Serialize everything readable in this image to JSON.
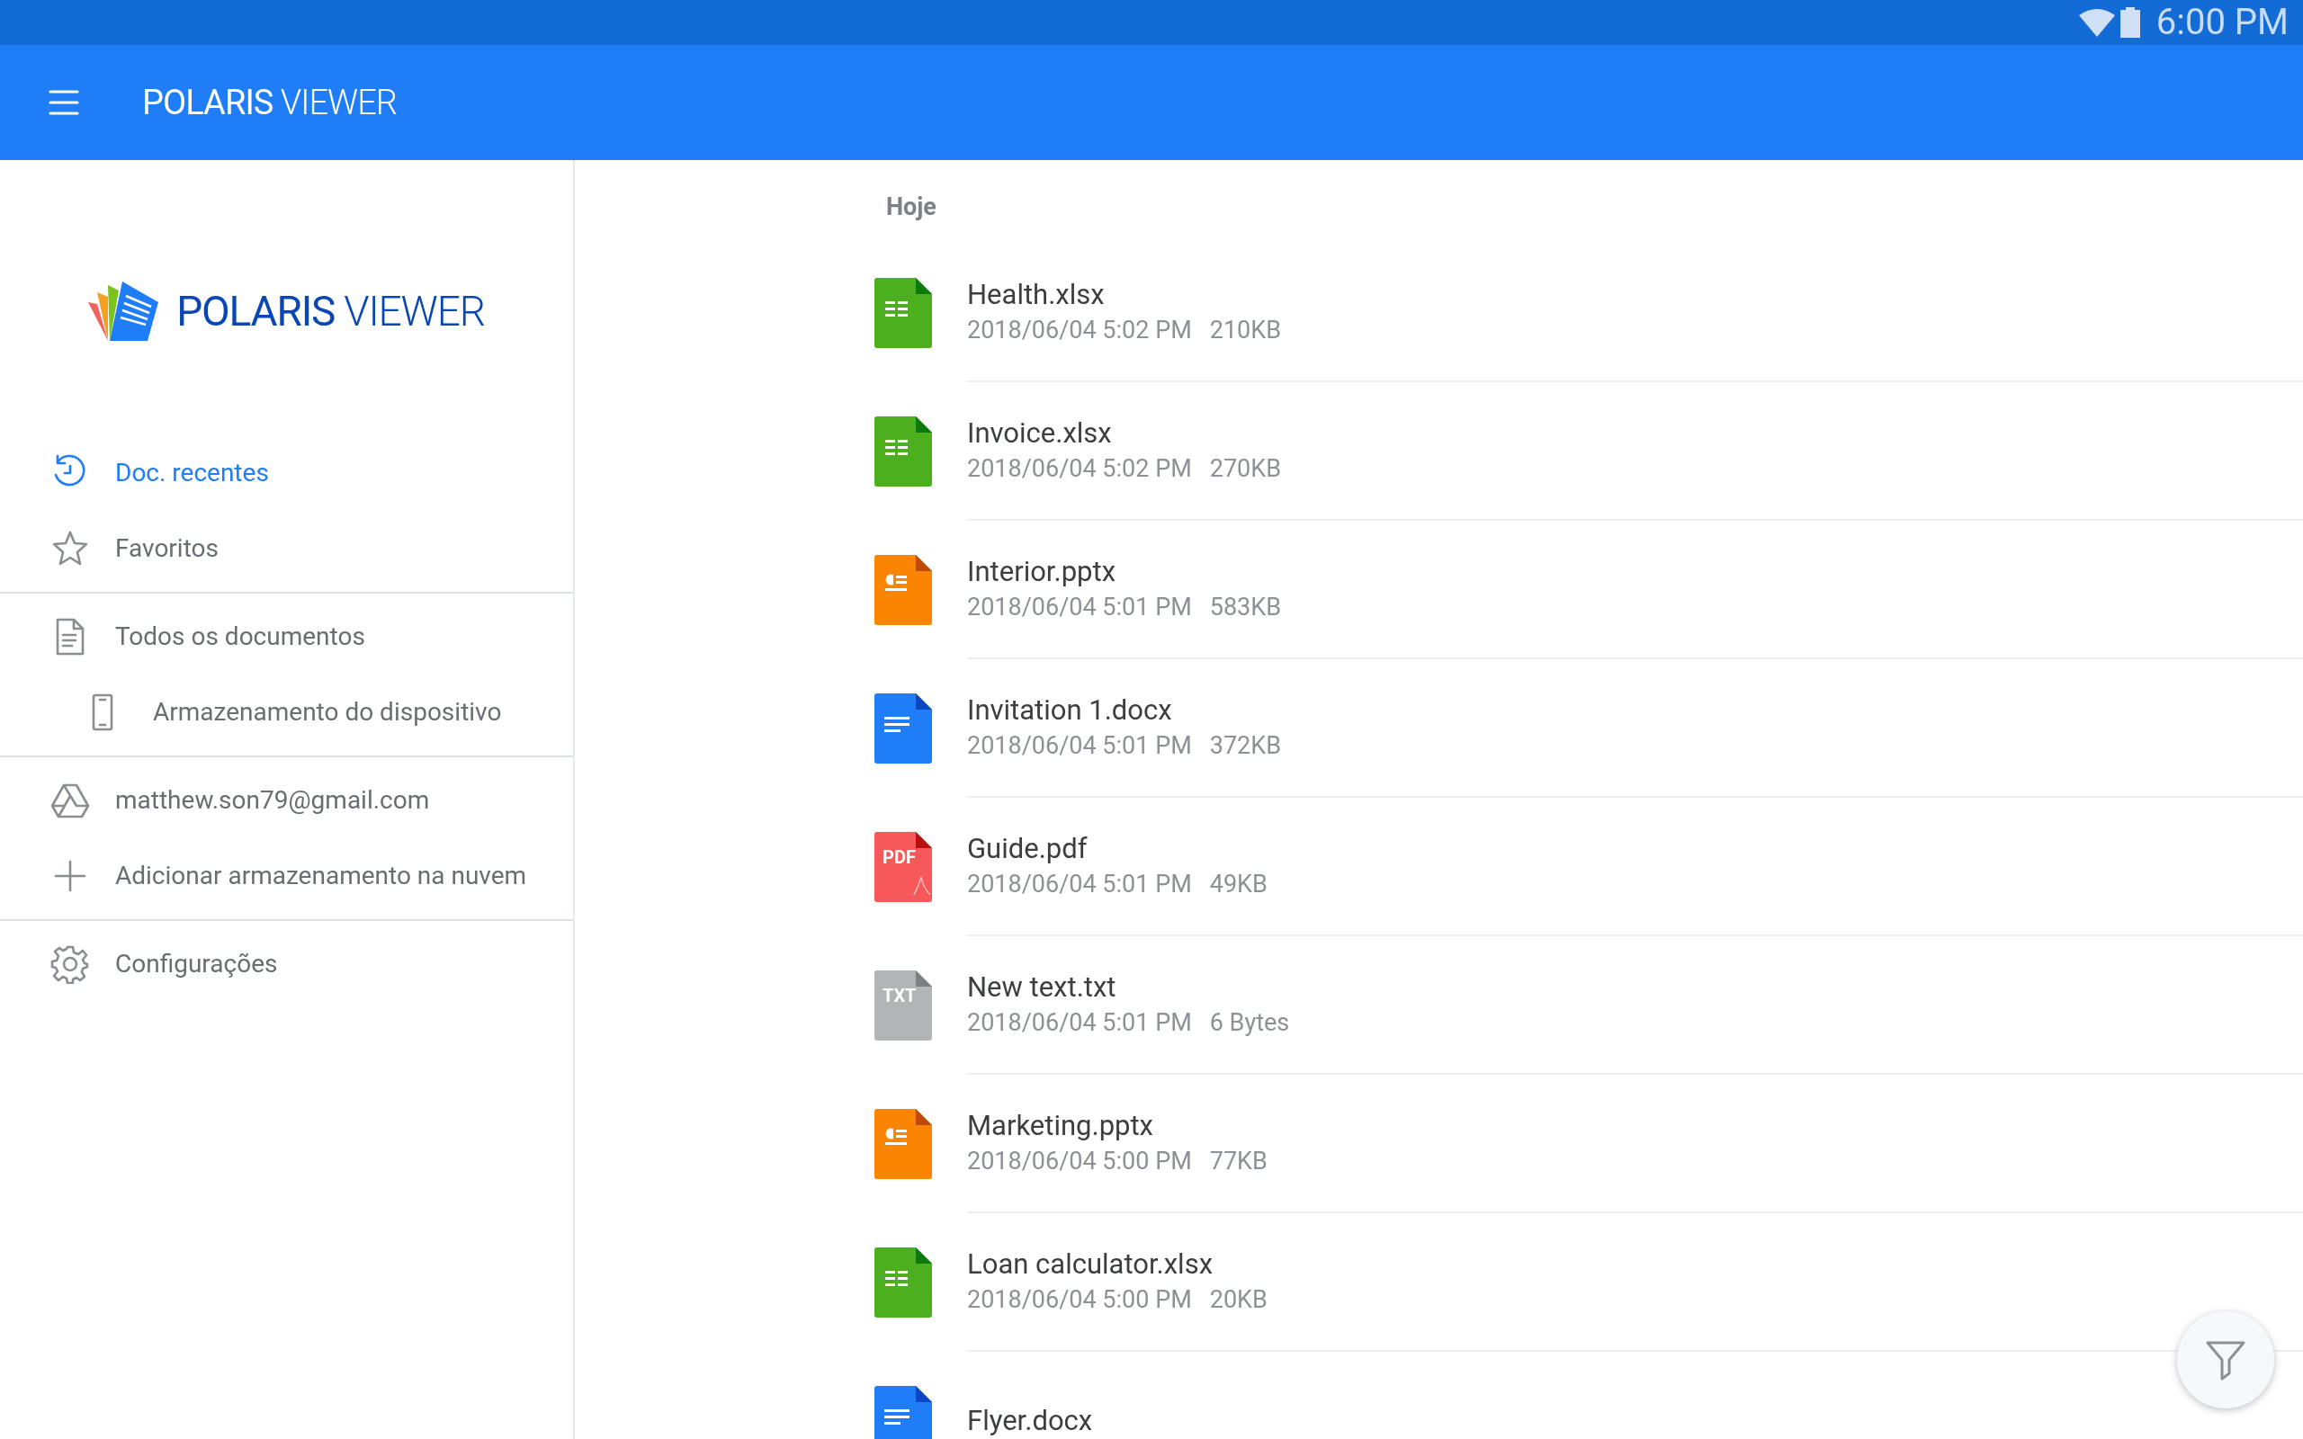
{
  "status_bar": {
    "time": "6:00 PM"
  },
  "app_bar": {
    "title": "**POLARIS** VIEWER"
  },
  "sidebar": {
    "logo_text": "**POLARIS** VIEWER",
    "groups": [
      {
        "items": [
          {
            "label": "Doc. recentes",
            "kind": "recent",
            "selected": true
          },
          {
            "label": "Favoritos",
            "kind": "star",
            "selected": false
          }
        ]
      },
      {
        "items": [
          {
            "label": "Todos os documentos",
            "kind": "doc",
            "selected": false,
            "children": [
              {
                "label": "Armazenamento do dispositivo",
                "kind": "phone",
                "selected": false
              }
            ]
          }
        ]
      },
      {
        "items": [
          {
            "label": "matthew.son79@gmail.com",
            "kind": "drive",
            "selected": false
          },
          {
            "label": "Adicionar armazenamento na nuvem",
            "kind": "plus",
            "selected": false
          }
        ]
      },
      {
        "items": [
          {
            "label": "Configurações",
            "kind": "gear",
            "selected": false
          }
        ]
      }
    ]
  },
  "file_list": {
    "section": "Hoje",
    "files": [
      {
        "name": "Health.xlsx",
        "date": "2018/06/04 5:02 PM",
        "size": "210KB",
        "kind": "sheet"
      },
      {
        "name": "Invoice.xlsx",
        "date": "2018/06/04 5:02 PM",
        "size": "270KB",
        "kind": "sheet"
      },
      {
        "name": "Interior.pptx",
        "date": "2018/06/04 5:01 PM",
        "size": "583KB",
        "kind": "slides"
      },
      {
        "name": "Invitation 1.docx",
        "date": "2018/06/04 5:01 PM",
        "size": "372KB",
        "kind": "doc"
      },
      {
        "name": "Guide.pdf",
        "date": "2018/06/04 5:01 PM",
        "size": "49KB",
        "kind": "pdf",
        "badge": "PDF"
      },
      {
        "name": "New text.txt",
        "date": "2018/06/04 5:01 PM",
        "size": "6 Bytes",
        "kind": "txt",
        "badge": "TXT"
      },
      {
        "name": "Marketing.pptx",
        "date": "2018/06/04 5:00 PM",
        "size": "77KB",
        "kind": "slides"
      },
      {
        "name": "Loan calculator.xlsx",
        "date": "2018/06/04 5:00 PM",
        "size": "20KB",
        "kind": "sheet"
      },
      {
        "name": "Flyer.docx",
        "kind": "doc"
      }
    ]
  }
}
